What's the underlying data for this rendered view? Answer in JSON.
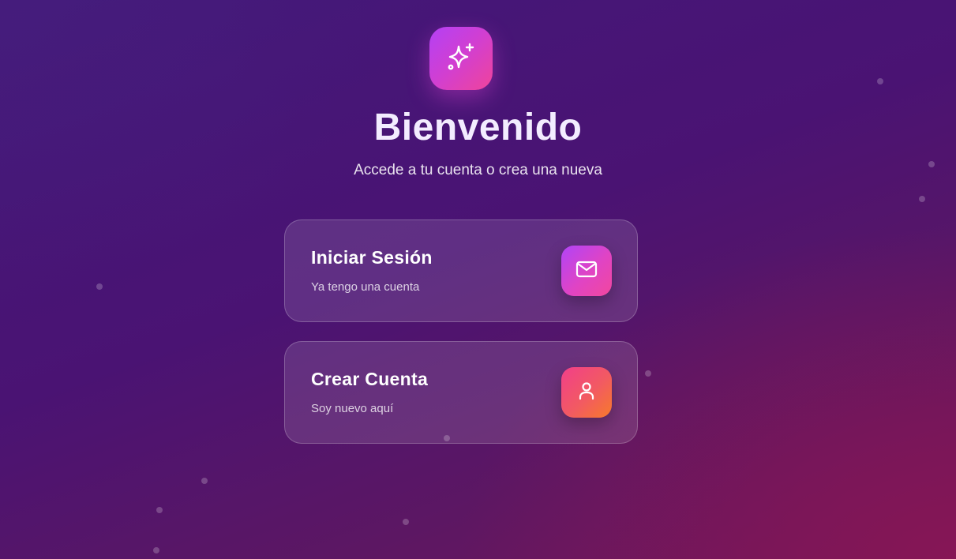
{
  "header": {
    "logo_icon": "sparkles-icon",
    "title": "Bienvenido",
    "subtitle": "Accede a tu cuenta o crea una nueva"
  },
  "options": {
    "login": {
      "title": "Iniciar Sesión",
      "subtitle": "Ya tengo una cuenta",
      "icon": "mail-icon"
    },
    "register": {
      "title": "Crear Cuenta",
      "subtitle": "Soy nuevo aquí",
      "icon": "user-icon"
    }
  },
  "colors": {
    "background_start": "#43197a",
    "background_end": "#72175a",
    "accent_purple": "#b440f5",
    "accent_pink": "#f0449a",
    "accent_orange": "#f77a2a"
  }
}
